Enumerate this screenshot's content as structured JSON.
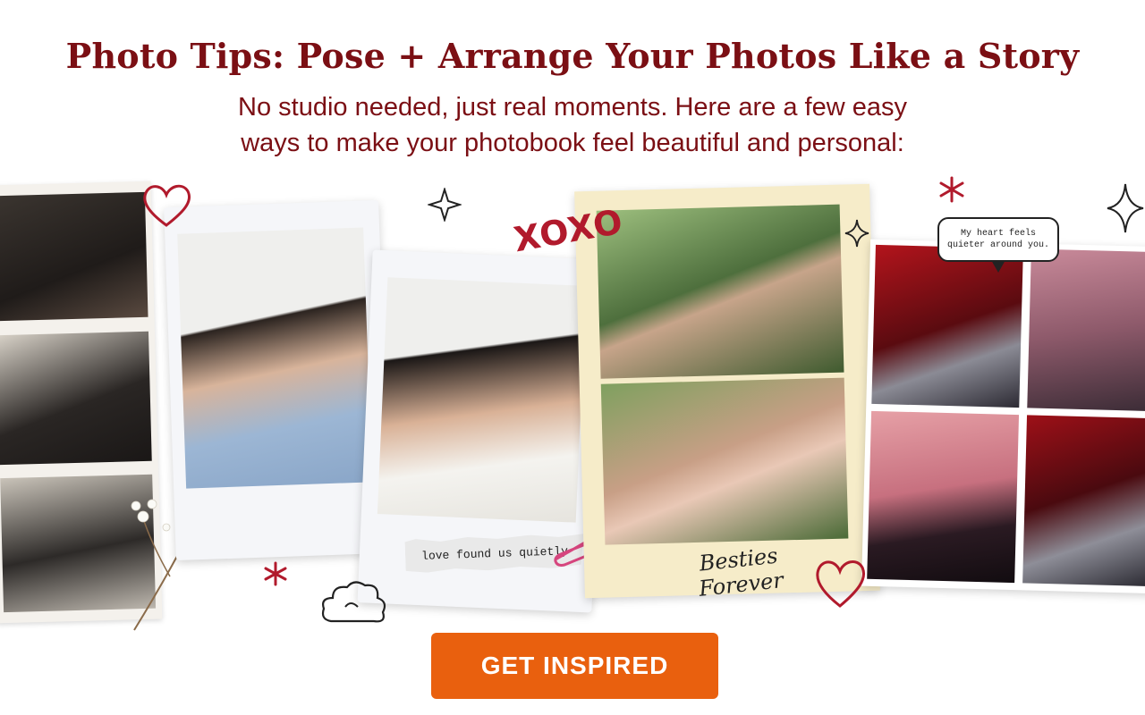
{
  "header": {
    "title": "Photo Tips: Pose + Arrange Your Photos Like a Story",
    "subtitle_line1": "No studio needed, just real moments. Here are a few easy",
    "subtitle_line2": "ways to make your photobook feel beautiful and personal:"
  },
  "collage": {
    "tape_note": "love found us quietly",
    "card_caption": "Besties Forever",
    "speech_bubble_line1": "My heart feels",
    "speech_bubble_line2": "quieter around you.",
    "doodle_text": "XOXO"
  },
  "cta": {
    "label": "GET INSPIRED",
    "color": "#e9600e"
  },
  "colors": {
    "title": "#7b0f14",
    "accent_red": "#b11a2c"
  }
}
